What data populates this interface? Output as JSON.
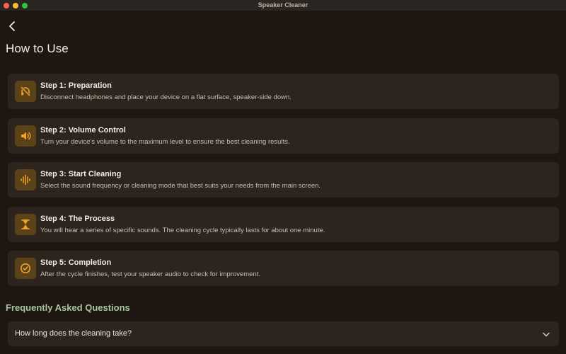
{
  "window": {
    "title": "Speaker Cleaner"
  },
  "page": {
    "title": "How to Use"
  },
  "steps": [
    {
      "title": "Step 1: Preparation",
      "description": "Disconnect headphones and place your device on a flat surface, speaker-side down.",
      "icon": "headphones-off-icon"
    },
    {
      "title": "Step 2: Volume Control",
      "description": "Turn your device's volume to the maximum level to ensure the best cleaning results.",
      "icon": "speaker-volume-icon"
    },
    {
      "title": "Step 3: Start Cleaning",
      "description": "Select the sound frequency or cleaning mode that best suits your needs from the main screen.",
      "icon": "sound-wave-icon"
    },
    {
      "title": "Step 4: The Process",
      "description": "You will hear a series of specific sounds. The cleaning cycle typically lasts for about one minute.",
      "icon": "hourglass-icon"
    },
    {
      "title": "Step 5: Completion",
      "description": "After the cycle finishes, test your speaker audio to check for improvement.",
      "icon": "check-circle-icon"
    }
  ],
  "faq": {
    "heading": "Frequently Asked Questions",
    "items": [
      {
        "question": "How long does the cleaning take?"
      }
    ]
  },
  "colors": {
    "background": "#1e1611",
    "card": "#2c241d",
    "icon_bg": "#5c4218",
    "accent": "#f0a524",
    "faq_heading": "#a9c79a"
  }
}
